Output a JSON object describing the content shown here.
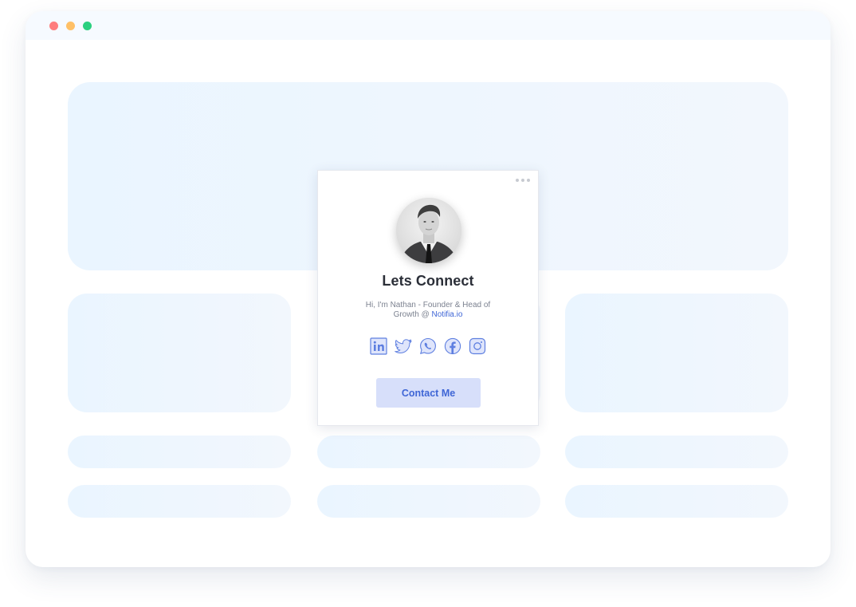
{
  "window": {
    "controls": [
      "close-dot",
      "minimize-dot",
      "maximize-dot"
    ],
    "colors": {
      "close": "#fe7d7d",
      "minimize": "#ffc066",
      "maximize": "#2bd07f"
    }
  },
  "widget": {
    "title": "Lets Connect",
    "intro": "Hi, I'm Nathan - Founder & Head of Growth @ ",
    "link_text": "Notifia.io",
    "button_label": "Contact Me",
    "socials": [
      "linkedin-icon",
      "twitter-icon",
      "whatsapp-icon",
      "facebook-icon",
      "instagram-icon"
    ],
    "accent": "#3f66d6",
    "button_bg": "#d7dffa"
  }
}
